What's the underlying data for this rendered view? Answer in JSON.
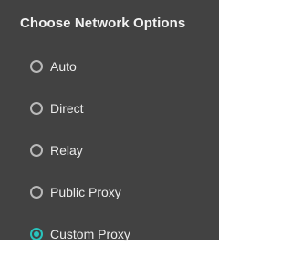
{
  "dialog": {
    "title": "Choose Network Options",
    "options": [
      {
        "label": "Auto",
        "selected": false
      },
      {
        "label": "Direct",
        "selected": false
      },
      {
        "label": "Relay",
        "selected": false
      },
      {
        "label": "Public Proxy",
        "selected": false
      },
      {
        "label": "Custom Proxy",
        "selected": true
      }
    ]
  },
  "colors": {
    "background": "#424242",
    "text": "#ececec",
    "radio_border": "#b9b9b9",
    "accent": "#29c4bd"
  }
}
